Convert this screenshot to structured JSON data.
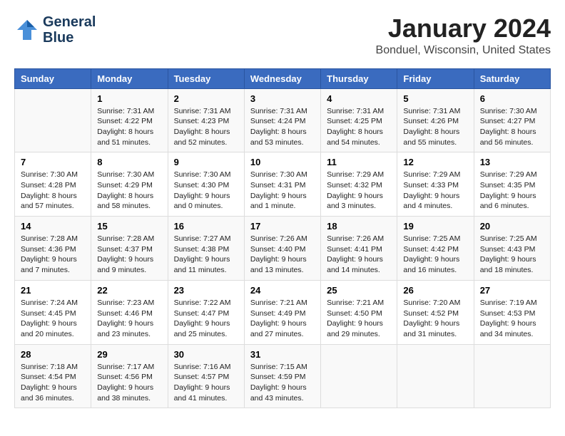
{
  "header": {
    "logo_line1": "General",
    "logo_line2": "Blue",
    "month_title": "January 2024",
    "location": "Bonduel, Wisconsin, United States"
  },
  "columns": [
    "Sunday",
    "Monday",
    "Tuesday",
    "Wednesday",
    "Thursday",
    "Friday",
    "Saturday"
  ],
  "weeks": [
    [
      {
        "day": "",
        "sunrise": "",
        "sunset": "",
        "daylight": ""
      },
      {
        "day": "1",
        "sunrise": "Sunrise: 7:31 AM",
        "sunset": "Sunset: 4:22 PM",
        "daylight": "Daylight: 8 hours and 51 minutes."
      },
      {
        "day": "2",
        "sunrise": "Sunrise: 7:31 AM",
        "sunset": "Sunset: 4:23 PM",
        "daylight": "Daylight: 8 hours and 52 minutes."
      },
      {
        "day": "3",
        "sunrise": "Sunrise: 7:31 AM",
        "sunset": "Sunset: 4:24 PM",
        "daylight": "Daylight: 8 hours and 53 minutes."
      },
      {
        "day": "4",
        "sunrise": "Sunrise: 7:31 AM",
        "sunset": "Sunset: 4:25 PM",
        "daylight": "Daylight: 8 hours and 54 minutes."
      },
      {
        "day": "5",
        "sunrise": "Sunrise: 7:31 AM",
        "sunset": "Sunset: 4:26 PM",
        "daylight": "Daylight: 8 hours and 55 minutes."
      },
      {
        "day": "6",
        "sunrise": "Sunrise: 7:30 AM",
        "sunset": "Sunset: 4:27 PM",
        "daylight": "Daylight: 8 hours and 56 minutes."
      }
    ],
    [
      {
        "day": "7",
        "sunrise": "Sunrise: 7:30 AM",
        "sunset": "Sunset: 4:28 PM",
        "daylight": "Daylight: 8 hours and 57 minutes."
      },
      {
        "day": "8",
        "sunrise": "Sunrise: 7:30 AM",
        "sunset": "Sunset: 4:29 PM",
        "daylight": "Daylight: 8 hours and 58 minutes."
      },
      {
        "day": "9",
        "sunrise": "Sunrise: 7:30 AM",
        "sunset": "Sunset: 4:30 PM",
        "daylight": "Daylight: 9 hours and 0 minutes."
      },
      {
        "day": "10",
        "sunrise": "Sunrise: 7:30 AM",
        "sunset": "Sunset: 4:31 PM",
        "daylight": "Daylight: 9 hours and 1 minute."
      },
      {
        "day": "11",
        "sunrise": "Sunrise: 7:29 AM",
        "sunset": "Sunset: 4:32 PM",
        "daylight": "Daylight: 9 hours and 3 minutes."
      },
      {
        "day": "12",
        "sunrise": "Sunrise: 7:29 AM",
        "sunset": "Sunset: 4:33 PM",
        "daylight": "Daylight: 9 hours and 4 minutes."
      },
      {
        "day": "13",
        "sunrise": "Sunrise: 7:29 AM",
        "sunset": "Sunset: 4:35 PM",
        "daylight": "Daylight: 9 hours and 6 minutes."
      }
    ],
    [
      {
        "day": "14",
        "sunrise": "Sunrise: 7:28 AM",
        "sunset": "Sunset: 4:36 PM",
        "daylight": "Daylight: 9 hours and 7 minutes."
      },
      {
        "day": "15",
        "sunrise": "Sunrise: 7:28 AM",
        "sunset": "Sunset: 4:37 PM",
        "daylight": "Daylight: 9 hours and 9 minutes."
      },
      {
        "day": "16",
        "sunrise": "Sunrise: 7:27 AM",
        "sunset": "Sunset: 4:38 PM",
        "daylight": "Daylight: 9 hours and 11 minutes."
      },
      {
        "day": "17",
        "sunrise": "Sunrise: 7:26 AM",
        "sunset": "Sunset: 4:40 PM",
        "daylight": "Daylight: 9 hours and 13 minutes."
      },
      {
        "day": "18",
        "sunrise": "Sunrise: 7:26 AM",
        "sunset": "Sunset: 4:41 PM",
        "daylight": "Daylight: 9 hours and 14 minutes."
      },
      {
        "day": "19",
        "sunrise": "Sunrise: 7:25 AM",
        "sunset": "Sunset: 4:42 PM",
        "daylight": "Daylight: 9 hours and 16 minutes."
      },
      {
        "day": "20",
        "sunrise": "Sunrise: 7:25 AM",
        "sunset": "Sunset: 4:43 PM",
        "daylight": "Daylight: 9 hours and 18 minutes."
      }
    ],
    [
      {
        "day": "21",
        "sunrise": "Sunrise: 7:24 AM",
        "sunset": "Sunset: 4:45 PM",
        "daylight": "Daylight: 9 hours and 20 minutes."
      },
      {
        "day": "22",
        "sunrise": "Sunrise: 7:23 AM",
        "sunset": "Sunset: 4:46 PM",
        "daylight": "Daylight: 9 hours and 23 minutes."
      },
      {
        "day": "23",
        "sunrise": "Sunrise: 7:22 AM",
        "sunset": "Sunset: 4:47 PM",
        "daylight": "Daylight: 9 hours and 25 minutes."
      },
      {
        "day": "24",
        "sunrise": "Sunrise: 7:21 AM",
        "sunset": "Sunset: 4:49 PM",
        "daylight": "Daylight: 9 hours and 27 minutes."
      },
      {
        "day": "25",
        "sunrise": "Sunrise: 7:21 AM",
        "sunset": "Sunset: 4:50 PM",
        "daylight": "Daylight: 9 hours and 29 minutes."
      },
      {
        "day": "26",
        "sunrise": "Sunrise: 7:20 AM",
        "sunset": "Sunset: 4:52 PM",
        "daylight": "Daylight: 9 hours and 31 minutes."
      },
      {
        "day": "27",
        "sunrise": "Sunrise: 7:19 AM",
        "sunset": "Sunset: 4:53 PM",
        "daylight": "Daylight: 9 hours and 34 minutes."
      }
    ],
    [
      {
        "day": "28",
        "sunrise": "Sunrise: 7:18 AM",
        "sunset": "Sunset: 4:54 PM",
        "daylight": "Daylight: 9 hours and 36 minutes."
      },
      {
        "day": "29",
        "sunrise": "Sunrise: 7:17 AM",
        "sunset": "Sunset: 4:56 PM",
        "daylight": "Daylight: 9 hours and 38 minutes."
      },
      {
        "day": "30",
        "sunrise": "Sunrise: 7:16 AM",
        "sunset": "Sunset: 4:57 PM",
        "daylight": "Daylight: 9 hours and 41 minutes."
      },
      {
        "day": "31",
        "sunrise": "Sunrise: 7:15 AM",
        "sunset": "Sunset: 4:59 PM",
        "daylight": "Daylight: 9 hours and 43 minutes."
      },
      {
        "day": "",
        "sunrise": "",
        "sunset": "",
        "daylight": ""
      },
      {
        "day": "",
        "sunrise": "",
        "sunset": "",
        "daylight": ""
      },
      {
        "day": "",
        "sunrise": "",
        "sunset": "",
        "daylight": ""
      }
    ]
  ]
}
